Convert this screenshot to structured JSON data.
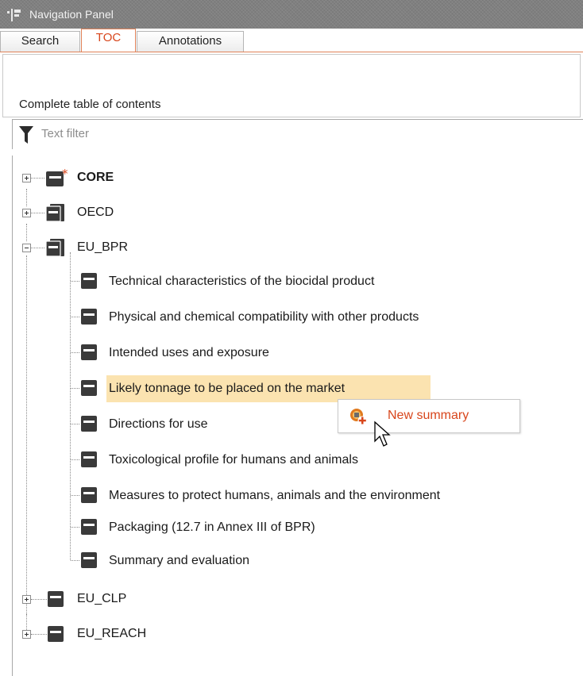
{
  "panel": {
    "title": "Navigation Panel"
  },
  "tabs": [
    {
      "label": "Search",
      "active": false
    },
    {
      "label": "TOC",
      "active": true
    },
    {
      "label": "Annotations",
      "active": false
    }
  ],
  "toc": {
    "header": "Complete table of contents",
    "filter_placeholder": "Text filter"
  },
  "tree": {
    "roots": [
      {
        "label": "CORE",
        "expanded": false,
        "bold": true,
        "marked": true
      },
      {
        "label": "OECD",
        "expanded": false
      },
      {
        "label": "EU_BPR",
        "expanded": true,
        "children": [
          "Technical characteristics of the biocidal product",
          "Physical and chemical compatibility with other products",
          "Intended uses and exposure",
          "Likely tonnage to be placed on the market",
          "Directions for use",
          "Toxicological profile for humans and animals",
          "Measures to protect humans, animals and the environment",
          "Packaging (12.7 in Annex III of BPR)",
          "Summary and evaluation"
        ]
      },
      {
        "label": "EU_CLP",
        "expanded": false
      },
      {
        "label": "EU_REACH",
        "expanded": false
      }
    ],
    "selected_item": "Likely tonnage to be placed on the market"
  },
  "context_menu": {
    "item": "New summary"
  },
  "colors": {
    "accent": "#d8461c",
    "highlight": "#fbe3b0",
    "titlebar": "#808080"
  }
}
